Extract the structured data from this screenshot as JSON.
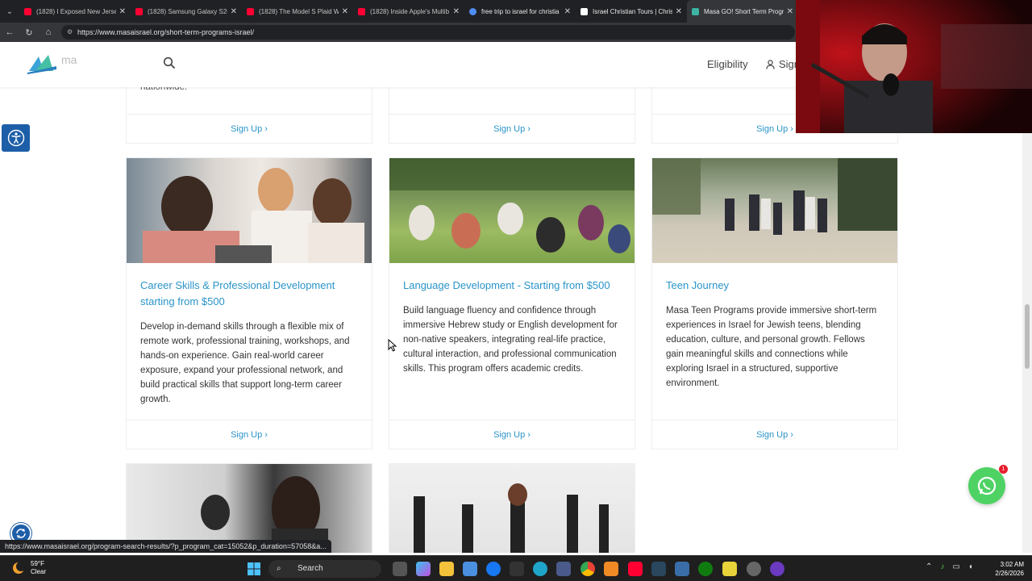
{
  "browser": {
    "tabs": [
      {
        "label": "(1828) I Exposed New Jerse",
        "favicon_color": "#ff0033",
        "favicon": "youtube-icon"
      },
      {
        "label": "(1828) Samsung Galaxy S26",
        "favicon_color": "#ff0033",
        "favicon": "youtube-icon"
      },
      {
        "label": "(1828) The Model S Plaid W",
        "favicon_color": "#ff0033",
        "favicon": "youtube-icon"
      },
      {
        "label": "(1828) Inside Apple's Multib",
        "favicon_color": "#ff0033",
        "favicon": "youtube-icon"
      },
      {
        "label": "free trip to israel for christia",
        "favicon_color": "#4e8df5",
        "favicon": "search-icon"
      },
      {
        "label": "Israel Christian Tours | Christ",
        "favicon_color": "#ffffff",
        "favicon": "site-icon"
      },
      {
        "label": "Masa GO! Short Term Progra",
        "favicon_color": "#3db4a3",
        "favicon": "masa-icon"
      }
    ],
    "url": "https://www.masaisrael.org/short-term-programs-israel/",
    "status_url": "https://www.masaisrael.org/program-search-results/?p_program_cat=15052&p_duration=57058&a..."
  },
  "header": {
    "logo_text": "ma",
    "nav": {
      "eligibility": "Eligibility",
      "sign": "Sign"
    }
  },
  "top_row": {
    "partial_text": "nationwide.",
    "cta": [
      "Sign Up ›",
      "Sign Up ›",
      "Sign Up ›"
    ]
  },
  "cards": [
    {
      "title": "Career Skills & Professional Development starting from $500",
      "description": "Develop in-demand skills through a flexible mix of remote work, professional training, workshops, and hands-on experience. Gain real-world career exposure, expand your professional network, and build practical skills that support long-term career growth.",
      "cta": "Sign Up ›"
    },
    {
      "title": "Language Development - Starting from $500",
      "description": "Build language fluency and confidence through immersive Hebrew study or English development for non-native speakers, integrating real-life practice, cultural interaction, and professional communication skills. This program offers academic credits.",
      "cta": "Sign Up ›"
    },
    {
      "title": "Teen Journey",
      "description": "Masa Teen Programs provide immersive short-term experiences in Israel for Jewish teens, blending education, culture, and personal growth. Fellows gain meaningful skills and connections while exploring Israel in a structured, supportive environment.",
      "cta": "Sign Up ›"
    }
  ],
  "widgets": {
    "whatsapp_badge": "1"
  },
  "colors": {
    "accent": "#2a94c8",
    "access_blue": "#1d5ea8",
    "whatsapp": "#4fd264"
  },
  "taskbar": {
    "weather_temp": "59°F",
    "weather_desc": "Clear",
    "search_label": "Search",
    "time": "3:02 AM",
    "date": "2/26/2026"
  }
}
